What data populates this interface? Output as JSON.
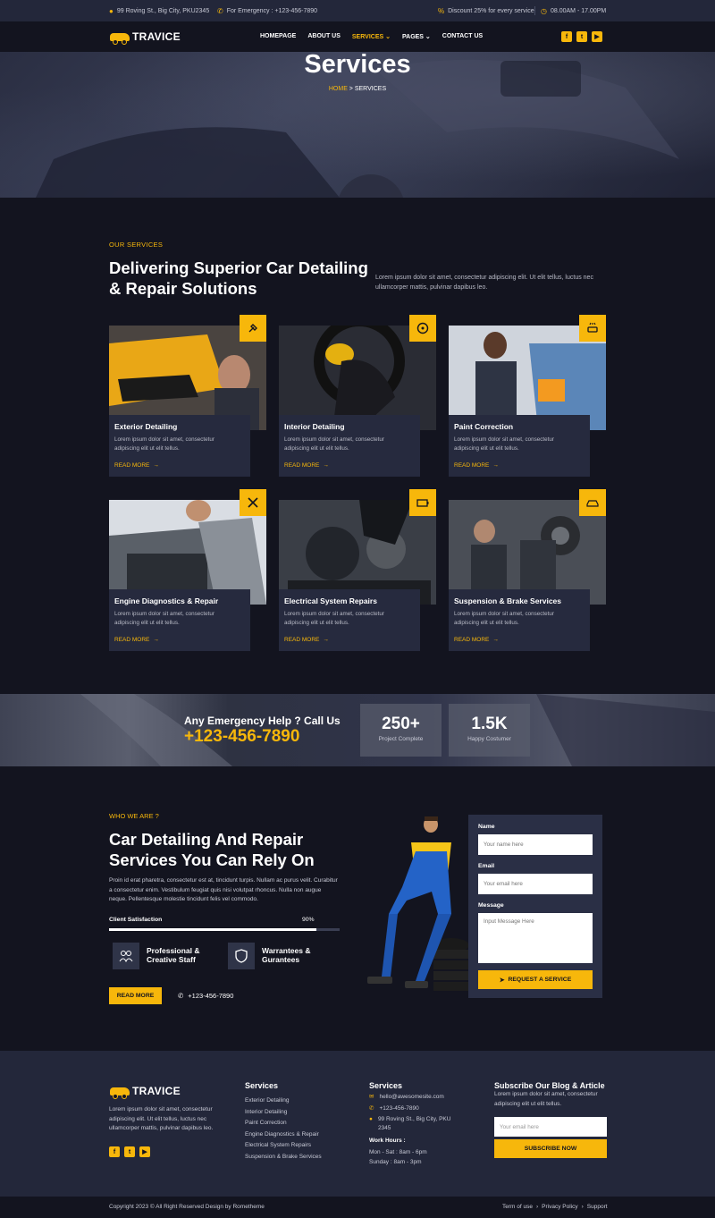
{
  "topbar": {
    "address": "99 Roving St., Big City, PKU2345",
    "emergency": "For Emergency : +123-456-7890",
    "discount": "Discount 25% for every service",
    "hours": "08.00AM - 17.00PM"
  },
  "brand": {
    "name": "TRAVICE"
  },
  "nav": {
    "items": [
      {
        "label": "HOMEPAGE"
      },
      {
        "label": "ABOUT US"
      },
      {
        "label": "SERVICES ⌄",
        "active": true
      },
      {
        "label": "PAGES ⌄"
      },
      {
        "label": "CONTACT US"
      }
    ],
    "social": [
      "f",
      "t",
      "▶"
    ]
  },
  "hero": {
    "title": "Services",
    "crumb_home": "HOME",
    "crumb_sep": " > ",
    "crumb_current": "SERVICES"
  },
  "services": {
    "subtitle": "OUR SERVICES",
    "title": "Delivering Superior Car Detailing & Repair Solutions",
    "desc": "Lorem ipsum dolor sit amet, consectetur adipiscing elit. Ut elit tellus, luctus nec ullamcorper mattis, pulvinar dapibus leo.",
    "read_more": "READ MORE",
    "cards": [
      {
        "title": "Exterior Detailing",
        "desc": "Lorem ipsum dolor sit amet, consectetur adipiscing elit ut elit tellus.",
        "icon": "brush-icon"
      },
      {
        "title": "Interior Detailing",
        "desc": "Lorem ipsum dolor sit amet, consectetur adipiscing elit ut elit tellus.",
        "icon": "steering-wheel-icon"
      },
      {
        "title": "Paint Correction",
        "desc": "Lorem ipsum dolor sit amet, consectetur adipiscing elit ut elit tellus.",
        "icon": "car-wash-icon"
      },
      {
        "title": "Engine Diagnostics & Repair",
        "desc": "Lorem ipsum dolor sit amet, consectetur adipiscing elit ut elit tellus.",
        "icon": "tools-icon"
      },
      {
        "title": "Electrical System Repairs",
        "desc": "Lorem ipsum dolor sit amet, consectetur adipiscing elit ut elit tellus.",
        "icon": "battery-icon"
      },
      {
        "title": "Suspension & Brake Services",
        "desc": "Lorem ipsum dolor sit amet, consectetur adipiscing elit ut elit tellus.",
        "icon": "car-icon"
      }
    ]
  },
  "emergency": {
    "question": "Any Emergency Help ? Call Us",
    "phone": "+123-456-7890",
    "stats": [
      {
        "value": "250+",
        "label": "Project Complete"
      },
      {
        "value": "1.5K",
        "label": "Happy Costumer"
      }
    ]
  },
  "about": {
    "subtitle": "WHO WE ARE ?",
    "title": "Car Detailing And Repair Services You Can Rely On",
    "desc": "Proin id erat pharetra, consectetur est at, tincidunt turpis. Nullam ac purus velit. Curabitur a consectetur enim. Vestibulum feugiat quis nisi volutpat rhoncus. Nulla non augue neque. Pellentesque molestie tincidunt felis vel commodo.",
    "satisfaction_label": "Client Satisfaction",
    "satisfaction_value": "90%",
    "satisfaction_level": 0.9,
    "features": [
      {
        "line1": "Professional &",
        "line2": "Creative Staff",
        "icon": "team-icon"
      },
      {
        "line1": "Warrantees &",
        "line2": "Gurantees",
        "icon": "shield-icon"
      }
    ],
    "button": "READ MORE",
    "phone": "+123-456-7890"
  },
  "form": {
    "name_label": "Name",
    "name_placeholder": "Your name here",
    "email_label": "Email",
    "email_placeholder": "Your email here",
    "message_label": "Message",
    "message_placeholder": "Input Message Here",
    "button": "REQUEST A SERVICE"
  },
  "footer": {
    "about": "Lorem ipsum dolor sit amet, consectetur adipiscing elit. Ut elit tellus, luctus nec ullamcorper mattis, pulvinar dapibus leo.",
    "col2_title": "Services",
    "col2_links": [
      "Exterior Detailing",
      "Interior Detailing",
      "Paint Correction",
      "Engine Diagnostics & Repair",
      "Electrical System Repairs",
      "Suspension & Brake Services"
    ],
    "col3_title": "Services",
    "email": "hello@awesomesite.com",
    "phone": "+123-456-7890",
    "address_line1": "99 Roving St., Big City, PKU",
    "address_line2": "2345",
    "hours_title": "Work Hours :",
    "hours_1": "Mon - Sat : 8am - 6pm",
    "hours_2": "Sunday : 8am - 3pm",
    "col4_title": "Subscribe Our Blog & Article",
    "col4_desc": "Lorem ipsum dolor sit amet, consectetur adipiscing elit ut elit tellus.",
    "email_placeholder": "Your email here",
    "subscribe": "SUBSCRIBE NOW",
    "copyright": "Copyright 2023 © All Right Reserved Design by Rometheme",
    "links": [
      "Term of use",
      "›",
      "Privacy Policy",
      "›",
      "Support"
    ]
  },
  "colors": {
    "accent": "#f7b70b",
    "bg": "#13141f",
    "panel": "#23273a",
    "card": "#262a3e"
  }
}
